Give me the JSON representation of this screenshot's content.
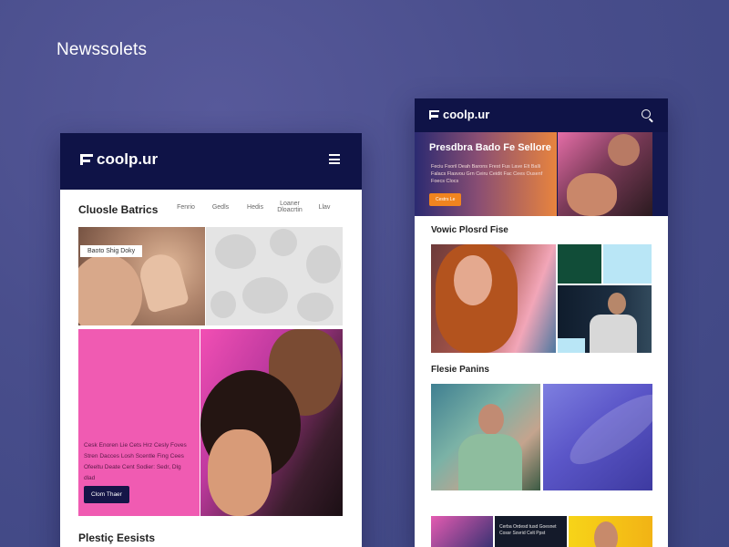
{
  "page": {
    "heading": "Newssolets"
  },
  "left_mockup": {
    "logo_text": "coolp.ur",
    "section_title": "Cluosle Batrics",
    "nav_links": [
      "Fenrio",
      "Gedls",
      "Hedis",
      "Loaner Dloacrtin",
      "Llav"
    ],
    "image_tag": "Baoto Shig Doky",
    "pink_panel_text": "Cesk Enoren Lie Cets Hrz Cesly Foves Stren Dacces Losh Scentle Fing Cees Ofeeltu Deate Cent Sodier: Sedr, Dlg dlad",
    "pink_button": "Clom Thaer",
    "bottom_title": "Plestiç Eesists"
  },
  "right_mockup": {
    "logo_text": "coolp.ur",
    "hero": {
      "title": "Presdbra Bado Fe Sellore",
      "text": "Feciu Fsoril Deah Barons Frest Fus Lave Elt Balli Falacs Flasvou Grn Ceiru Ceidit Fac Cees Ousenf Foecs Clocs",
      "button": "Cestrs Le"
    },
    "section1_title": "Vowic Plosrd Fise",
    "section2_title": "Flesie Panins",
    "strip_caption": "Cerba Ordesd tusd Goesnet Cossr Sovrid Celt Ppst"
  },
  "colors": {
    "navy": "#0f1347",
    "pink": "#f05bb2",
    "orange": "#f0841f",
    "background": "#494e8c"
  }
}
